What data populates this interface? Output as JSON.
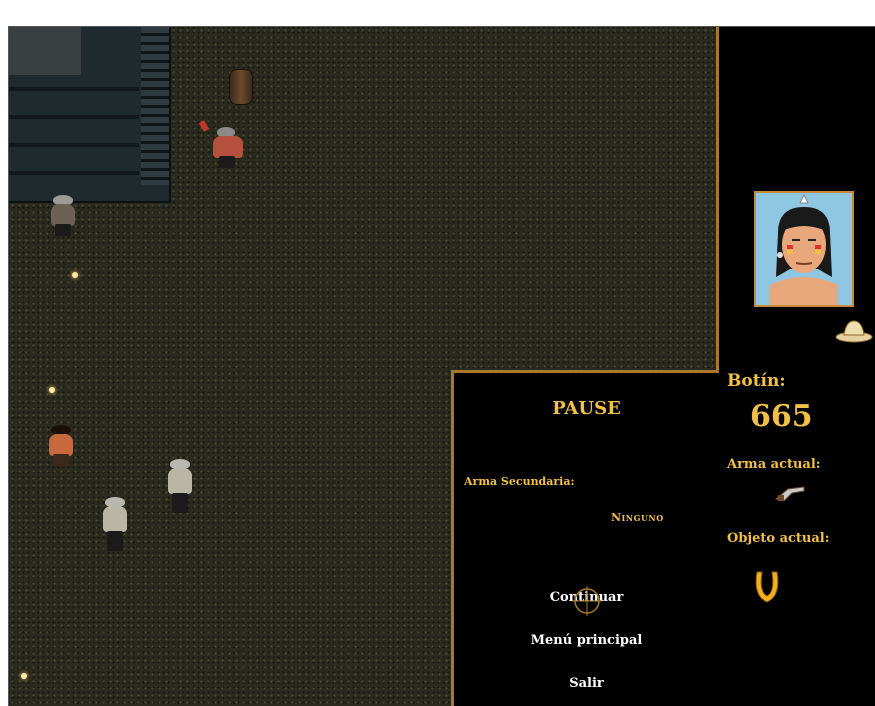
{
  "game": {
    "pause_menu": {
      "title": "PAUSE",
      "secondary_weapon_label": "Arma Secundaria:",
      "secondary_weapon_value": "Ninguno",
      "items": [
        "Continuar",
        "Menú principal",
        "Salir"
      ]
    },
    "hud": {
      "loot_label": "Botín:",
      "loot_value": "665",
      "current_weapon_label": "Arma actual:",
      "current_weapon_icon": "revolver-icon",
      "current_item_label": "Objeto actual:",
      "current_item_icon": "horseshoe-icon",
      "hat_icon": "cowboy-hat-icon",
      "portrait": "native-chief-portrait"
    },
    "colors": {
      "accent": "#f0c048",
      "border": "#a8782a",
      "ground": "#2b2a1f"
    }
  }
}
